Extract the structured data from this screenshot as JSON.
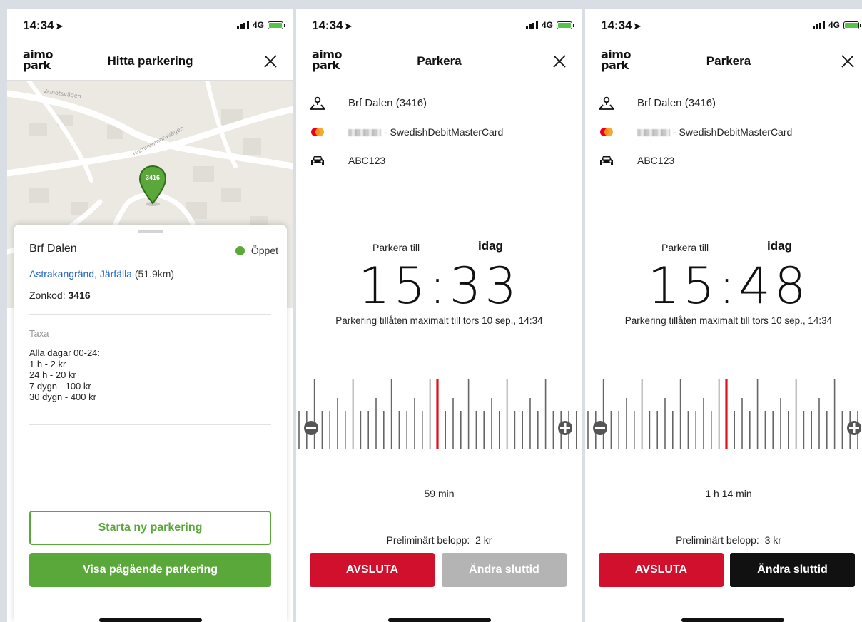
{
  "status": {
    "time": "14:34",
    "network": "4G"
  },
  "colors": {
    "green": "#5aa83a",
    "red": "#d0102c",
    "gray": "#b4b4b4",
    "black": "#111111",
    "link": "#1f63c9",
    "needle": "#e0101e"
  },
  "logo": {
    "line1": "aimo",
    "line2": "park"
  },
  "screen1": {
    "title": "Hitta parkering",
    "map": {
      "roads": [
        "Valnötsvägen",
        "Hummelmoravägen"
      ],
      "pin_label": "3416"
    },
    "sheet": {
      "name": "Brf Dalen",
      "status": "Öppet",
      "address_link": "Astrakangränd, Järfälla",
      "distance": "(51.9km)",
      "zone_label": "Zonkod:",
      "zone_code": "3416",
      "taxa_label": "Taxa",
      "rates": [
        "Alla dagar 00-24:",
        "1 h - 2 kr",
        "24 h - 20 kr",
        "7 dygn - 100 kr",
        "30 dygn - 400 kr"
      ]
    },
    "buttons": {
      "start": "Starta ny parkering",
      "show": "Visa pågående parkering"
    }
  },
  "screen2": {
    "title": "Parkera",
    "location": "Brf Dalen (3416)",
    "card": "- SwedishDebitMasterCard",
    "plate": "ABC123",
    "park_until_label": "Parkera till",
    "day": "idag",
    "end_time": "15:33",
    "max_text": "Parkering tillåten maximalt till tors 10 sep., 14:34",
    "duration": "59 min",
    "price_label": "Preliminärt belopp:",
    "price": "2 kr",
    "btn_end": "AVSLUTA",
    "btn_change": "Ändra sluttid"
  },
  "screen3": {
    "title": "Parkera",
    "location": "Brf Dalen (3416)",
    "card": "- SwedishDebitMasterCard",
    "plate": "ABC123",
    "park_until_label": "Parkera till",
    "day": "idag",
    "end_time": "15:48",
    "max_text": "Parkering tillåten maximalt till tors 10 sep., 14:34",
    "duration": "1 h 14 min",
    "price_label": "Preliminärt belopp:",
    "price": "3 kr",
    "btn_end": "AVSLUTA",
    "btn_change": "Ändra sluttid"
  },
  "icons": {
    "location": "map-pin-person-icon",
    "card": "mastercard-icon",
    "car": "car-icon",
    "close": "close-icon",
    "minus": "minus-circle-icon",
    "plus": "plus-circle-icon"
  }
}
